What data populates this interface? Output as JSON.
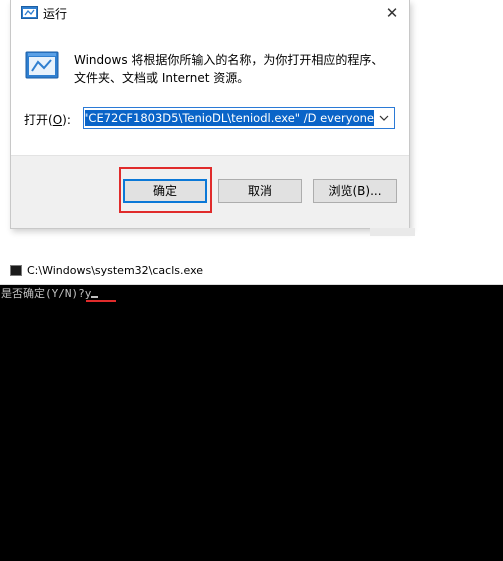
{
  "run_dialog": {
    "title": "运行",
    "close_glyph": "✕",
    "description": "Windows 将根据你所输入的名称，为你打开相应的程序、文件夹、文档或 Internet 资源。",
    "open_label": "打开(",
    "open_label_key": "O",
    "open_label_end": "):",
    "command_value": "\"CE72CF1803D5\\TenioDL\\teniodl.exe\" /D everyone",
    "buttons": {
      "ok": "确定",
      "cancel": "取消",
      "browse": "浏览(B)..."
    },
    "icons": {
      "title": "run-icon",
      "big": "run-icon",
      "dropdown": "chevron-down-icon",
      "close": "close-icon"
    },
    "highlight_color": "#e02b2b",
    "selection_color": "#0a64c8"
  },
  "console": {
    "title": "C:\\Windows\\system32\\cacls.exe",
    "prompt": "是否确定(Y/N)?",
    "input": "y",
    "icon": "console-icon",
    "underline_color": "#e02b2b"
  }
}
